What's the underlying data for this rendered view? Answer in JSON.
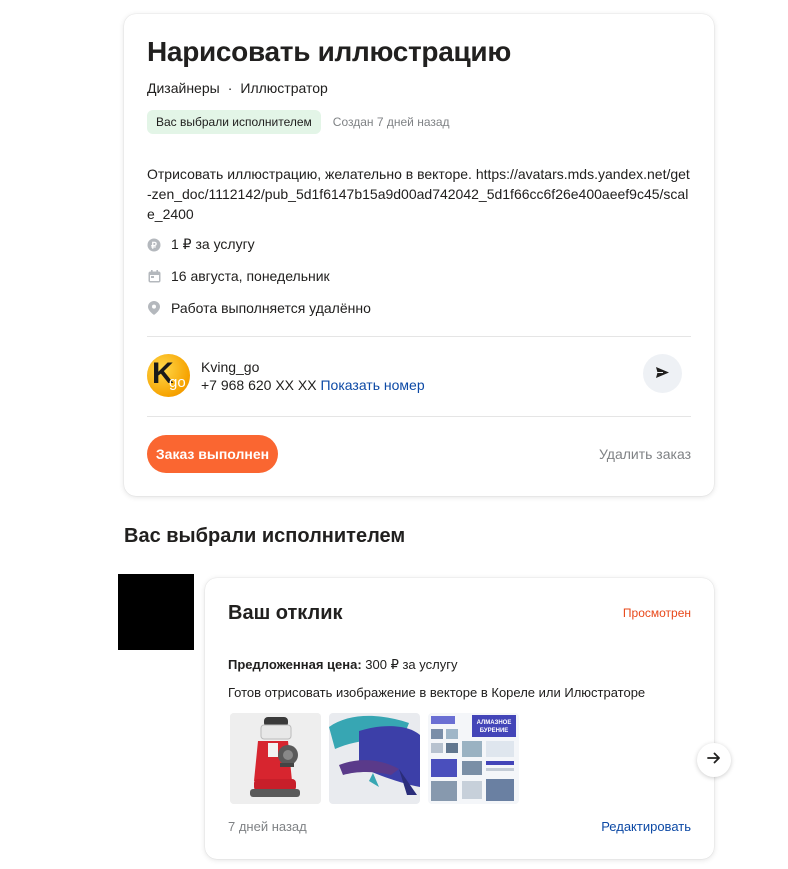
{
  "order": {
    "title": "Нарисовать иллюстрацию",
    "categories": [
      "Дизайнеры",
      "Иллюстратор"
    ],
    "separator": "·",
    "badge": "Вас выбрали исполнителем",
    "created": "Создан 7 дней назад",
    "description": "Отрисовать иллюстрацию, желательно в векторе. https://avatars.mds.yandex.net/get-zen_doc/1112142/pub_5d1f6147b15a9d00ad742042_5d1f66cc6f26e400aeef9c45/scale_2400",
    "price": "1 ₽ за услугу",
    "date": "16 августа, понедельник",
    "location": "Работа выполняется удалённо",
    "customer": {
      "name": "Kving_go",
      "phone": "+7 968 620 XX XX",
      "show_number": "Показать номер",
      "avatar_letter": "K",
      "avatar_small": "go"
    },
    "done_button": "Заказ выполнен",
    "delete_link": "Удалить заказ"
  },
  "section_title": "Вас выбрали исполнителем",
  "reply": {
    "title": "Ваш отклик",
    "status": "Просмотрен",
    "price_label": "Предложенная цена:",
    "price_value": " 300 ₽ за услугу",
    "text": "Готов отрисовать изображение в векторе в Кореле или Илюстраторе",
    "time_ago": "7 дней назад",
    "edit_link": "Редактировать",
    "thumb3_heading": "АЛМАЗНОЕ БУРЕНИЕ"
  },
  "icons": {
    "ruble": "ruble-icon",
    "calendar": "calendar-icon",
    "location": "location-pin-icon",
    "send": "send-icon",
    "arrow": "arrow-right-icon"
  },
  "colors": {
    "accent": "#fa6631",
    "link": "#0c49a5",
    "badge_bg": "#e3f5e7",
    "status": "#e8481a",
    "muted": "#7f8285"
  }
}
